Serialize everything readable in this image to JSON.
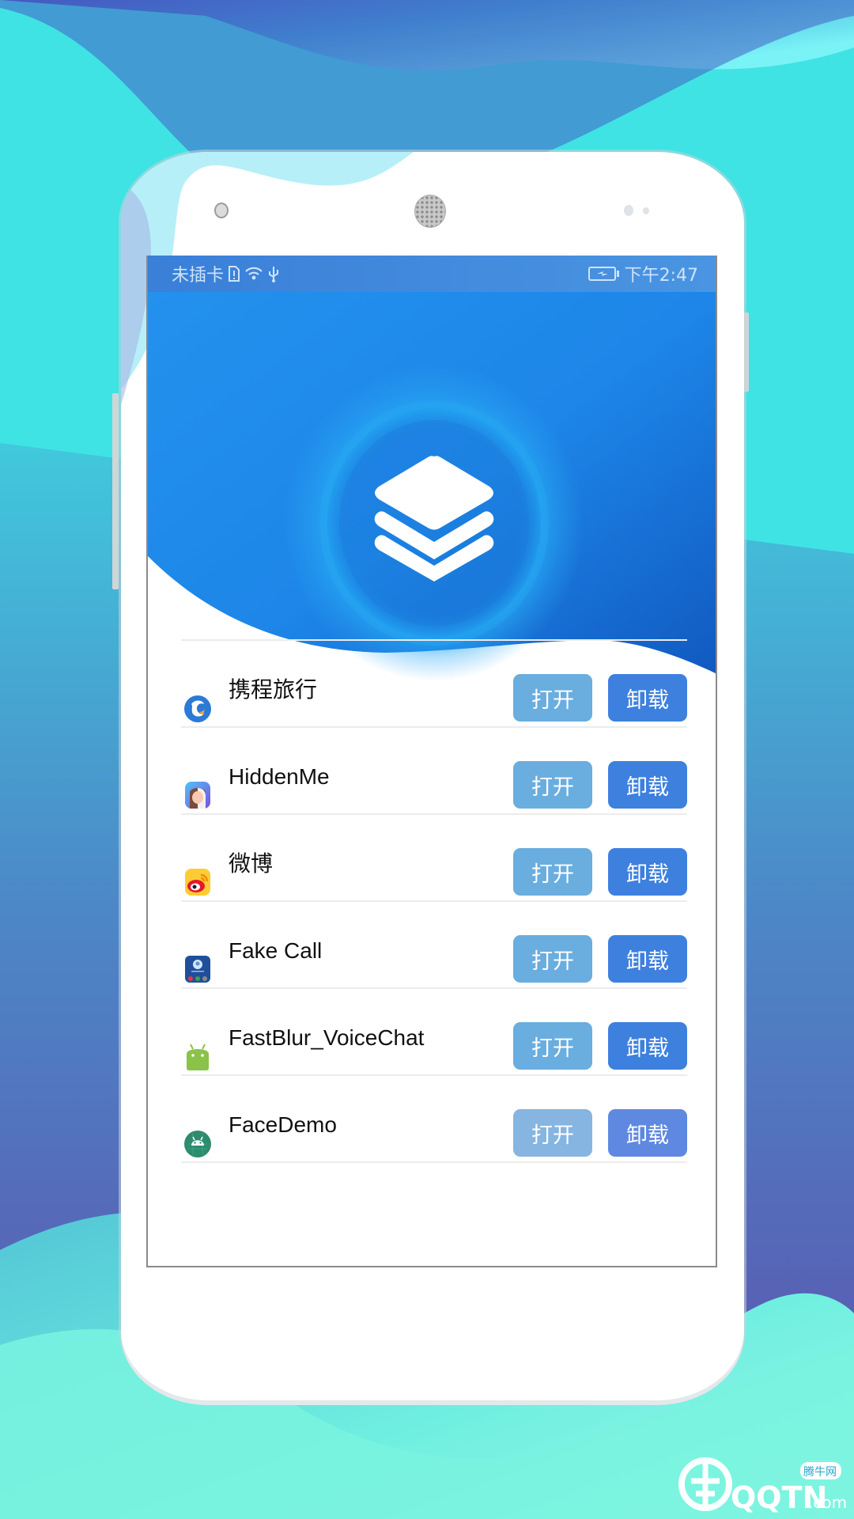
{
  "status_bar": {
    "carrier": "未插卡",
    "time": "下午2:47",
    "icons": [
      "sim-alert-icon",
      "wifi-icon",
      "usb-icon",
      "battery-charging-icon"
    ]
  },
  "header": {
    "logo_icon": "layers-stack-icon"
  },
  "apps": [
    {
      "name": "携程旅行",
      "icon": "ctrip-dolphin-icon",
      "open_label": "打开",
      "uninstall_label": "卸载"
    },
    {
      "name": "HiddenMe",
      "icon": "hiddenme-face-icon",
      "open_label": "打开",
      "uninstall_label": "卸载"
    },
    {
      "name": "微博",
      "icon": "weibo-icon",
      "open_label": "打开",
      "uninstall_label": "卸载"
    },
    {
      "name": "Fake Call",
      "icon": "fake-call-icon",
      "open_label": "打开",
      "uninstall_label": "卸载"
    },
    {
      "name": "FastBlur_VoiceChat",
      "icon": "android-icon",
      "open_label": "打开",
      "uninstall_label": "卸载"
    },
    {
      "name": "FaceDemo",
      "icon": "android-round-icon",
      "open_label": "打开",
      "uninstall_label": "卸载"
    }
  ],
  "watermark": {
    "brand": "QQTN",
    "suffix": ".com",
    "badge": "腾牛网"
  },
  "colors": {
    "header_blue": "#1f7fe6",
    "open_button": "#6aaddf",
    "uninstall_button": "#3e80de",
    "status_bar": "#3d86dc"
  }
}
